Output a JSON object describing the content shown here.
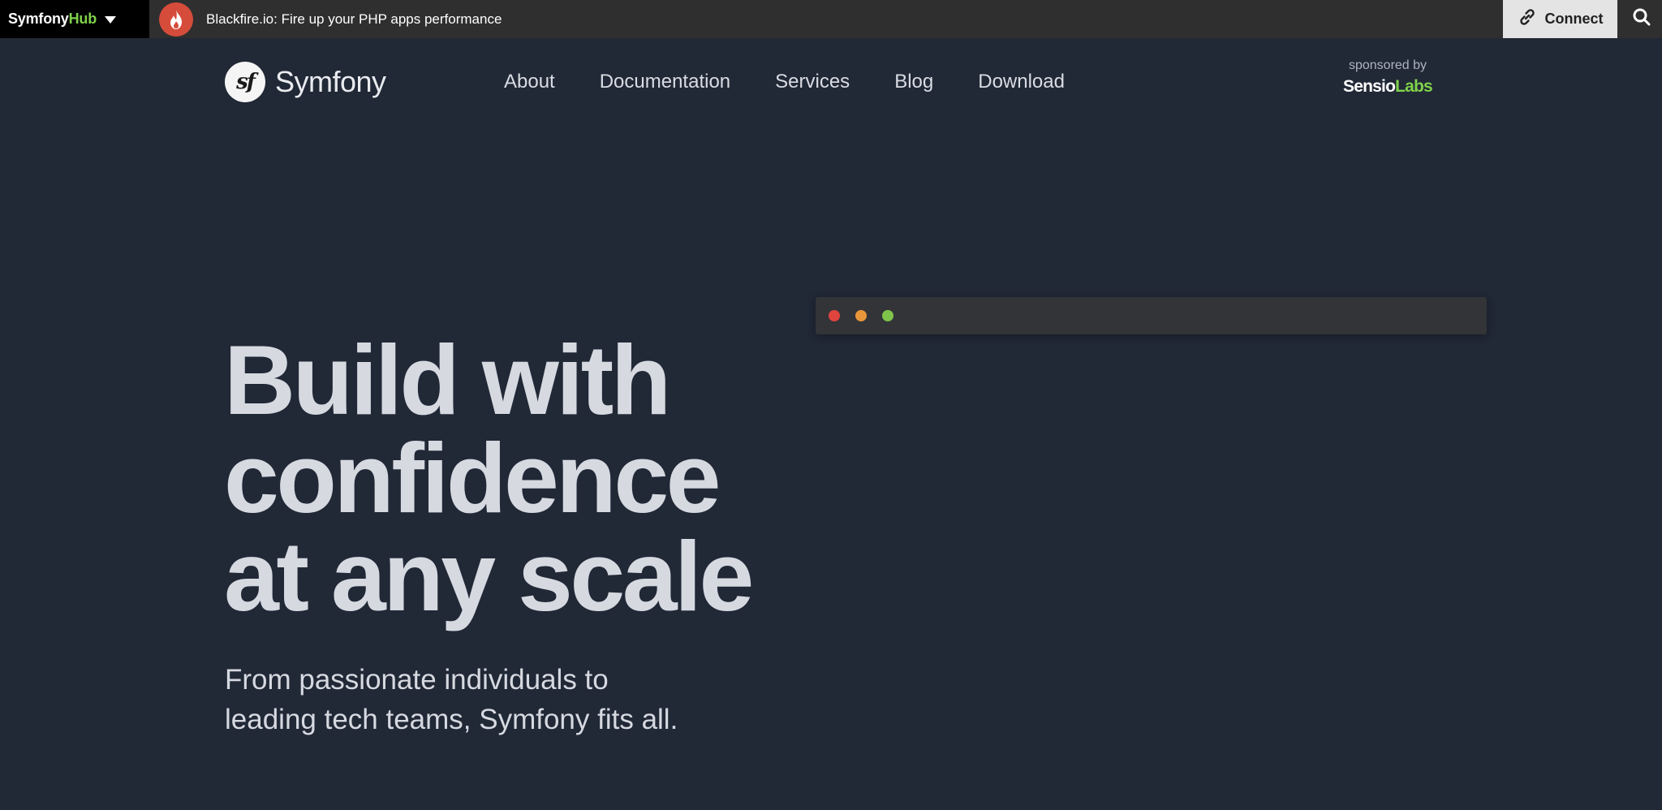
{
  "hubbar": {
    "brand_prefix": "Symfony",
    "brand_suffix": "Hub",
    "promo_text": "Blackfire.io: Fire up your PHP apps performance",
    "connect_label": "Connect"
  },
  "header": {
    "logo_text": "Symfony",
    "logo_mark": "sf",
    "nav": [
      "About",
      "Documentation",
      "Services",
      "Blog",
      "Download"
    ],
    "sponsor_label": "sponsored by",
    "sponsor_brand_a": "Sensio",
    "sponsor_brand_b": "Labs"
  },
  "hero": {
    "title_lines": [
      "Build with",
      "confidence",
      "at any scale"
    ],
    "subtitle_lines": [
      "From passionate individuals to",
      "leading tech teams, Symfony fits all."
    ]
  },
  "terminal": {
    "dots": [
      {
        "name": "close",
        "color": "#e0443e"
      },
      {
        "name": "minimize",
        "color": "#e9963a"
      },
      {
        "name": "maximize",
        "color": "#7fc44a"
      }
    ]
  },
  "colors": {
    "background": "#212836",
    "accent_green": "#7fd14a",
    "hubbar": "#2f2f2f",
    "promo_badge": "#d64c3b"
  },
  "icons": {
    "hub_menu": "caret-down-icon",
    "promo": "flame-icon",
    "connect": "link-icon",
    "search": "search-icon"
  }
}
